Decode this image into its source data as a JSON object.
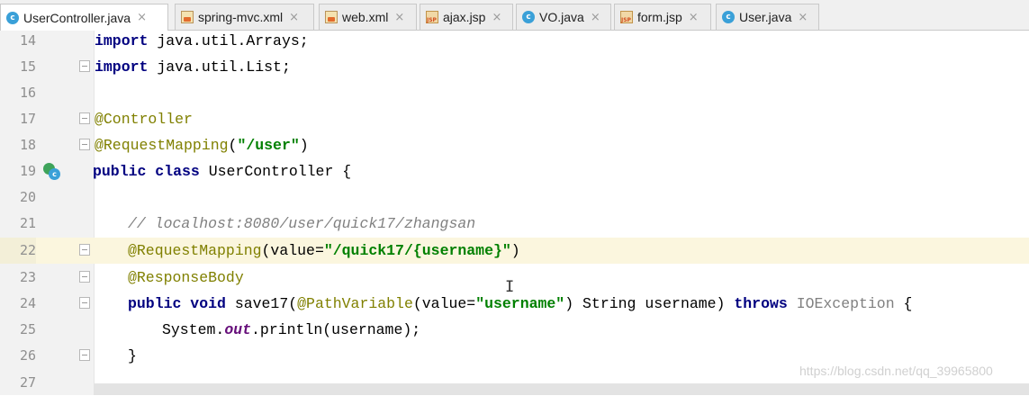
{
  "tabs": [
    {
      "label": "UserController.java",
      "icon": "java-class-icon",
      "active": true
    },
    {
      "label": "spring-mvc.xml",
      "icon": "xml-file-icon",
      "active": false
    },
    {
      "label": "web.xml",
      "icon": "xml-file-icon",
      "active": false
    },
    {
      "label": "ajax.jsp",
      "icon": "jsp-file-icon",
      "active": false
    },
    {
      "label": "VO.java",
      "icon": "java-class-icon",
      "active": false
    },
    {
      "label": "form.jsp",
      "icon": "jsp-file-icon",
      "active": false
    },
    {
      "label": "User.java",
      "icon": "java-class-icon",
      "active": false
    }
  ],
  "tab_icon_letter": "c",
  "tab_close_glyph": "×",
  "line_numbers": [
    "14",
    "15",
    "16",
    "17",
    "18",
    "19",
    "20",
    "21",
    "22",
    "23",
    "24",
    "25",
    "26",
    "27"
  ],
  "current_line": "22",
  "code": {
    "l14": {
      "kw": "import",
      "rest": " java.util.Arrays;"
    },
    "l15": {
      "kw": "import",
      "rest": " java.util.List;"
    },
    "l17": {
      "ann": "@Controller"
    },
    "l18": {
      "ann": "@RequestMapping",
      "p1": "(",
      "str": "\"/user\"",
      "p2": ")"
    },
    "l19": {
      "kw": "public class",
      "rest": " UserController {"
    },
    "l21": {
      "comment": "// localhost:8080/user/quick17/zhangsan"
    },
    "l22": {
      "ann": "@RequestMapping",
      "p1": "(value=",
      "str": "\"/quick17/{username}\"",
      "p2": ")"
    },
    "l23": {
      "ann": "@ResponseBody"
    },
    "l24": {
      "kw1": "public void",
      "a": " save17(",
      "ann": "@PathVariable",
      "b": "(value=",
      "str": "\"username\"",
      "c": ") String username) ",
      "kw2": "throws",
      "d": " ",
      "exc": "IOException",
      "e": " {"
    },
    "l25": {
      "a": "System.",
      "field": "out",
      "b": ".println(username);"
    },
    "l26": {
      "brace": "}"
    }
  },
  "watermark": "https://blog.csdn.net/qq_39965800",
  "colors": {
    "keyword": "#000080",
    "annotation": "#808000",
    "string": "#008000",
    "comment": "#808080",
    "field": "#660e7a",
    "current_line_bg": "#fbf6de"
  }
}
